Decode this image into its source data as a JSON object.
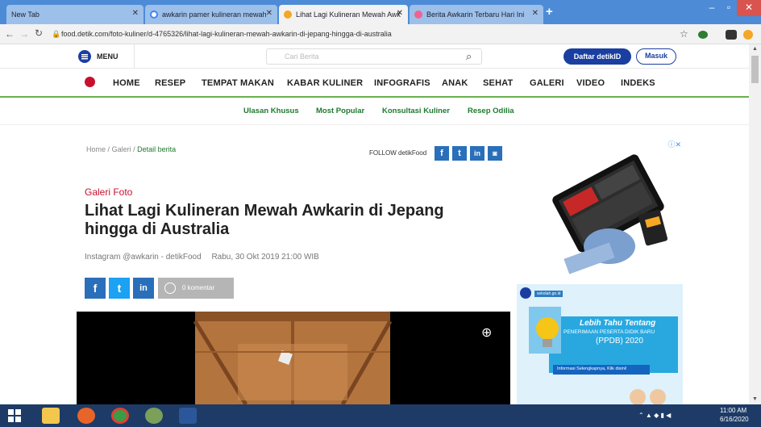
{
  "browser": {
    "tabs": [
      {
        "title": "New Tab"
      },
      {
        "title": "awkarin pamer kulineran mewah"
      },
      {
        "title": "Lihat Lagi Kulineran Mewah Awk"
      },
      {
        "title": "Berita Awkarin Terbaru Hari Ini"
      }
    ],
    "new_tab_symbol": "+",
    "url": "food.detik.com/foto-kuliner/d-4765326/lihat-lagi-kulineran-mewah-awkarin-di-jepang-hingga-di-australia"
  },
  "site": {
    "menu_label": "MENU",
    "search_placeholder": "Cari Berita",
    "register_label": "Daftar detikID",
    "login_label": "Masuk",
    "main_nav": [
      "HOME",
      "RESEP",
      "TEMPAT MAKAN",
      "KABAR KULINER",
      "INFOGRAFIS",
      "ANAK",
      "SEHAT",
      "GALERI",
      "VIDEO",
      "INDEKS"
    ],
    "sub_nav": [
      "Ulasan Khusus",
      "Most Popular",
      "Konsultasi Kuliner",
      "Resep Odilia"
    ]
  },
  "article": {
    "breadcrumb": {
      "home": "Home",
      "sep": "/",
      "galeri": "Galeri",
      "current": "Detail berita"
    },
    "follow_label": "FOLLOW detikFood",
    "category": "Galeri Foto",
    "title": "Lihat Lagi Kulineran Mewah Awkarin di Jepang hingga di Australia",
    "source": "Instagram @awkarin - detikFood",
    "date": "Rabu, 30 Okt 2019 21:00 WIB",
    "comments": "0 komentar"
  },
  "ads": {
    "ad2_site": "sekolah.go.id",
    "ad2_headline": "Lebih Tahu Tentang",
    "ad2_line1": "PENERIMAAN PESERTA DIDIK BARU",
    "ad2_line2": "(PPDB) 2020",
    "ad2_cta": "Informasi Selengkapnya, Klik disini!"
  },
  "taskbar": {
    "time": "11:00 AM",
    "date": "6/16/2020"
  },
  "colors": {
    "tabbar": "#4d8bd6",
    "detik_blue": "#1a3fa0",
    "green": "#6ab04c",
    "red": "#c8102e"
  }
}
